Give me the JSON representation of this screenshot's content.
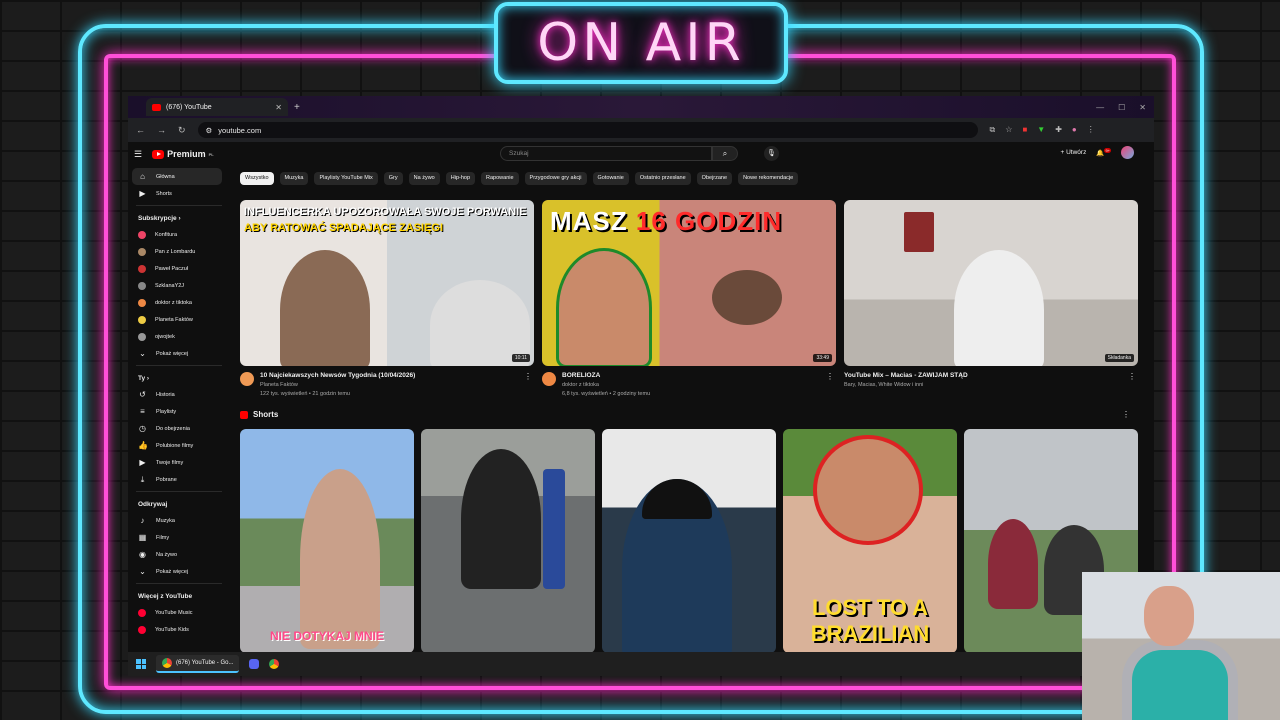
{
  "overlay": {
    "on_air": "ON AIR"
  },
  "browser": {
    "tab_title": "(676) YouTube",
    "url": "youtube.com"
  },
  "youtube": {
    "logo_text": "Premium",
    "logo_sup": "PL",
    "search_placeholder": "Szukaj",
    "create_label": "Utwórz",
    "notif_badge": "9+",
    "sidebar": {
      "home": "Główna",
      "shorts": "Shorts",
      "subs_header": "Subskrypcje",
      "subs": [
        {
          "label": "Konfitura",
          "color": "#e46"
        },
        {
          "label": "Pan z Lombardu",
          "color": "#a86"
        },
        {
          "label": "Paweł Paczuł",
          "color": "#c33"
        },
        {
          "label": "SzklanaY2J",
          "color": "#888"
        },
        {
          "label": "doktor z tiktoka",
          "color": "#e84"
        },
        {
          "label": "Planeta Faktów",
          "color": "#ec4"
        },
        {
          "label": "ojwojtek",
          "color": "#999"
        }
      ],
      "show_more": "Pokaż więcej",
      "you_header": "Ty",
      "you_items": [
        "Historia",
        "Playlisty",
        "Do obejrzenia",
        "Polubione filmy",
        "Twoje filmy",
        "Pobrane"
      ],
      "explore_header": "Odkrywaj",
      "explore_items": [
        "Muzyka",
        "Filmy",
        "Na żywo"
      ],
      "show_more2": "Pokaż więcej",
      "more_header": "Więcej z YouTube",
      "more_items": [
        "YouTube Music",
        "YouTube Kids"
      ]
    },
    "chips": [
      "Wszystko",
      "Muzyka",
      "Playlisty YouTube Mix",
      "Gry",
      "Na żywo",
      "Hip-hop",
      "Rapowanie",
      "Przygodowe gry akcji",
      "Gotowanie",
      "Ostatnio przesłane",
      "Obejrzane",
      "Nowe rekomendacje"
    ],
    "videos": [
      {
        "thumb_line1": "INFLUENCERKA UPOZOROWAŁA SWOJE PORWANIE",
        "thumb_line2": "ABY RATOWAĆ SPADAJĄCE ZASIĘGI",
        "duration": "10:11",
        "title": "10 Najciekawszych Newsów Tygodnia (10/04/2026)",
        "channel": "Planeta Faktów",
        "stats": "122 tys. wyświetleń • 21 godzin temu"
      },
      {
        "thumb_a": "MASZ",
        "thumb_b": "16 GODZIN",
        "duration": "33:49",
        "title": "BORELIOZA",
        "channel": "doktor z tiktoka",
        "stats": "6,8 tys. wyświetleń • 2 godziny temu"
      },
      {
        "duration": "Składanka",
        "title": "YouTube Mix – Macias - ZAWIJAM STĄD",
        "channel": "Bary, Macias, White Widow i inni",
        "stats": ""
      }
    ],
    "shorts_title": "Shorts",
    "shorts": [
      {
        "caption": "NIE DOTYKAJ MNIE"
      },
      {
        "caption": ""
      },
      {
        "caption": ""
      },
      {
        "caption": "LOST TO A BRAZILIAN"
      },
      {
        "caption": ""
      }
    ]
  },
  "taskbar": {
    "app_label": "(676) YouTube - Go..."
  }
}
